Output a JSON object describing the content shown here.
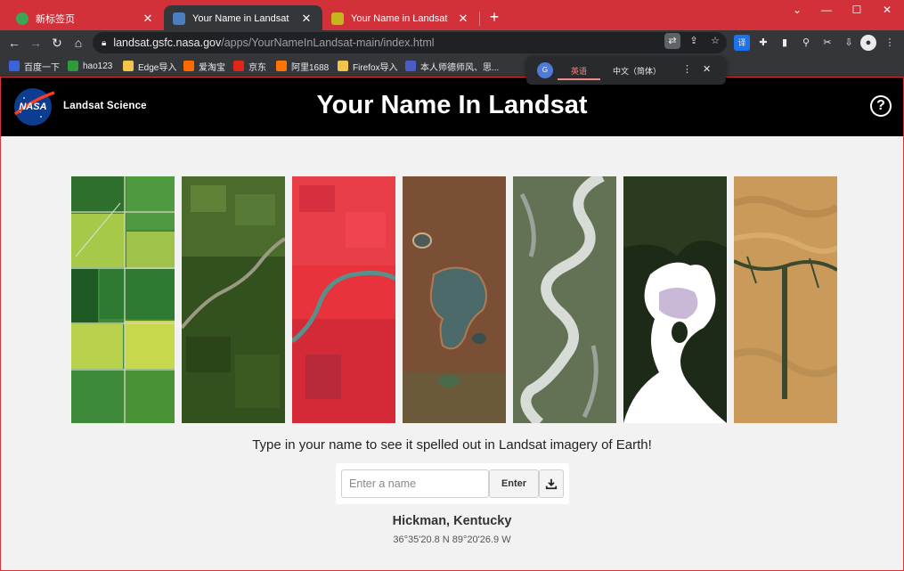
{
  "browser": {
    "tabs": [
      {
        "title": "新标签页",
        "favicon_color": "#3aa757"
      },
      {
        "title": "Your Name in Landsat",
        "favicon_color": "#4a7fbf",
        "active": true
      },
      {
        "title": "Your Name in Landsat",
        "favicon_color": "#c6b51d"
      }
    ],
    "url_host": "landsat.gsfc.nasa.gov",
    "url_path": "/apps/YourNameInLandsat-main/index.html",
    "bookmarks": [
      {
        "label": "百度一下",
        "color": "#3a62d9"
      },
      {
        "label": "hao123",
        "color": "#2e9a3a"
      },
      {
        "label": "Edge导入",
        "color": "#f0c54a"
      },
      {
        "label": "爱淘宝",
        "color": "#ff6a00"
      },
      {
        "label": "京东",
        "color": "#e1251b"
      },
      {
        "label": "阿里1688",
        "color": "#ff7300"
      },
      {
        "label": "Firefox导入",
        "color": "#f0c54a"
      },
      {
        "label": "本人师德师风、思...",
        "color": "#4b5cc4"
      }
    ],
    "translate": {
      "source": "英语",
      "target": "中文（简体）"
    }
  },
  "site": {
    "brand": "Landsat Science",
    "title": "Your Name In Landsat",
    "help": "?"
  },
  "letters": [
    {
      "name": "field-grid",
      "colors": [
        "#3f8a3a",
        "#a7c94a",
        "#1f5a24"
      ]
    },
    {
      "name": "river-forest",
      "colors": [
        "#33501f",
        "#587a37",
        "#9a9a80"
      ]
    },
    {
      "name": "red-river",
      "colors": [
        "#e8323c",
        "#b82a3a",
        "#5a8f8a"
      ]
    },
    {
      "name": "dry-lake",
      "colors": [
        "#7a4f35",
        "#4d6a6a",
        "#b07a50"
      ]
    },
    {
      "name": "winding-river",
      "colors": [
        "#3c4d2a",
        "#d8dcd6",
        "#9aa39a"
      ]
    },
    {
      "name": "ice-patches",
      "colors": [
        "#1e2a18",
        "#ffffff",
        "#c9b8d6"
      ]
    },
    {
      "name": "desert-dunes",
      "colors": [
        "#c99a5a",
        "#3b4a2f",
        "#e0b878"
      ]
    }
  ],
  "prompt": "Type in your name to see it spelled out in Landsat imagery of Earth!",
  "input": {
    "placeholder": "Enter a name",
    "enter_label": "Enter"
  },
  "location": {
    "name": "Hickman, Kentucky",
    "coords": "36°35'20.8 N 89°20'26.9 W"
  }
}
